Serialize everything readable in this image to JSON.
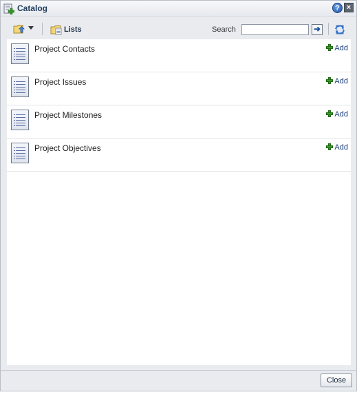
{
  "window": {
    "title": "Catalog",
    "help_icon": "help-icon",
    "close_icon": "close-icon"
  },
  "toolbar": {
    "folder_icon": "folder-up-icon",
    "lists_label": "Lists",
    "search_label": "Search",
    "search_value": "",
    "search_go_icon": "arrow-right-icon",
    "refresh_icon": "refresh-icon"
  },
  "catalog_items": [
    {
      "name": "Project Contacts",
      "add_label": "Add"
    },
    {
      "name": "Project Issues",
      "add_label": "Add"
    },
    {
      "name": "Project Milestones",
      "add_label": "Add"
    },
    {
      "name": "Project Objectives",
      "add_label": "Add"
    }
  ],
  "footer": {
    "close_label": "Close"
  },
  "colors": {
    "accent": "#1a3d7a",
    "add_icon": "#3b9a2c",
    "panel_bg": "#e9ebef"
  }
}
